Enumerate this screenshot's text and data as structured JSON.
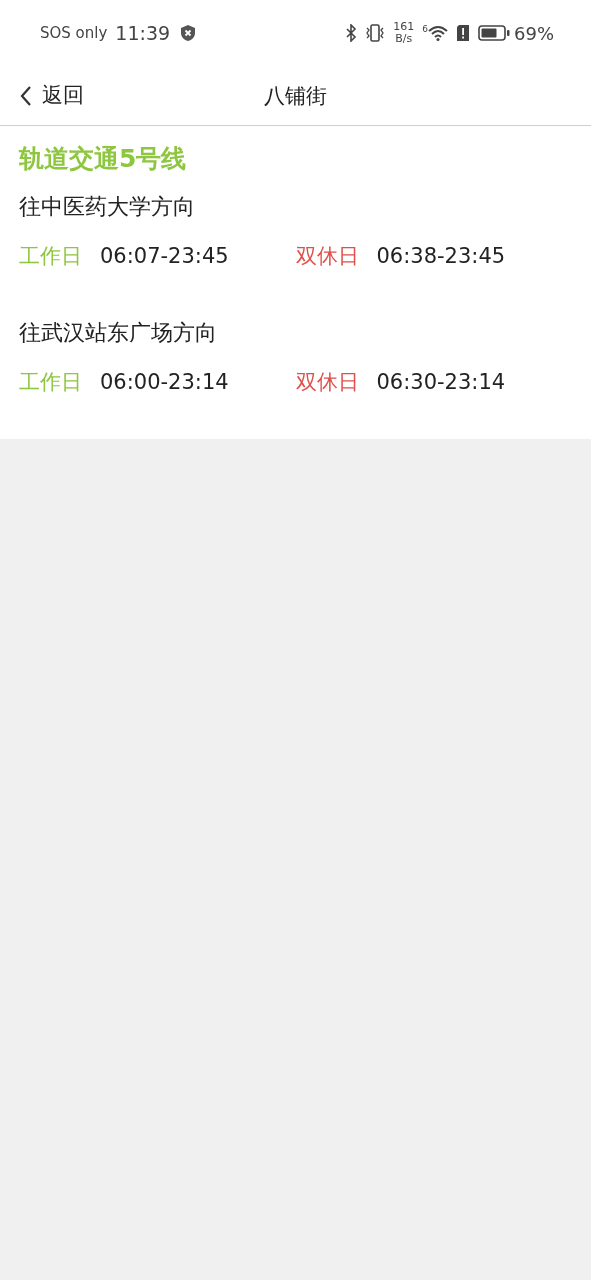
{
  "status_bar": {
    "carrier": "SOS only",
    "time": "11:39",
    "speed_value": "161",
    "speed_unit": "B/s",
    "wifi_label": "6",
    "battery": "69%"
  },
  "nav": {
    "back_label": "返回",
    "title": "八铺街"
  },
  "line": {
    "name": "轨道交通5号线",
    "directions": [
      {
        "name": "往中医药大学方向",
        "schedules": [
          {
            "kind": "workday",
            "label": "工作日",
            "hours": "06:07-23:45"
          },
          {
            "kind": "weekend",
            "label": "双休日",
            "hours": "06:38-23:45"
          }
        ]
      },
      {
        "name": "往武汉站东广场方向",
        "schedules": [
          {
            "kind": "workday",
            "label": "工作日",
            "hours": "06:00-23:14"
          },
          {
            "kind": "weekend",
            "label": "双休日",
            "hours": "06:30-23:14"
          }
        ]
      }
    ]
  }
}
